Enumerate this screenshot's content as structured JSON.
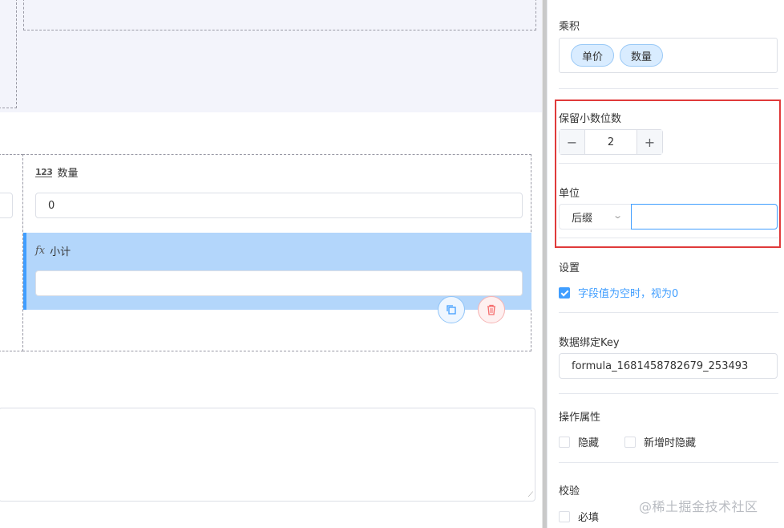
{
  "canvas": {
    "quantity_field": {
      "label": "数量",
      "icon": "number-123-icon",
      "value": "0"
    },
    "subtotal_field": {
      "label": "小计",
      "icon": "fx-formula-icon",
      "value": ""
    },
    "actions": {
      "copy_icon": "copy-icon",
      "delete_icon": "trash-icon"
    }
  },
  "panel": {
    "product": {
      "label": "乘积",
      "tags": [
        "单价",
        "数量"
      ]
    },
    "decimals": {
      "label": "保留小数位数",
      "value": "2",
      "minus": "−",
      "plus": "+"
    },
    "unit": {
      "label": "单位",
      "position_select": "后缀",
      "value": ""
    },
    "settings": {
      "label": "设置",
      "empty_as_zero": "字段值为空时，视为0",
      "empty_as_zero_checked": true
    },
    "binding_key": {
      "label": "数据绑定Key",
      "value": "formula_1681458782679_253493"
    },
    "operation": {
      "label": "操作属性",
      "hidden": "隐藏",
      "hidden_on_add": "新增时隐藏"
    },
    "validation": {
      "label": "校验",
      "required": "必填"
    }
  },
  "watermark": "@稀土掘金技术社区",
  "colors": {
    "accent": "#409eff",
    "selected_bg": "#b3d6fb",
    "highlight_frame": "#e03a3a",
    "danger": "#f56c6c"
  }
}
